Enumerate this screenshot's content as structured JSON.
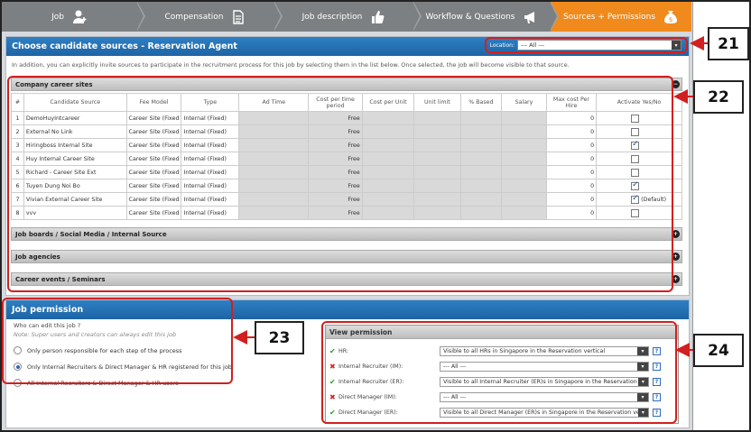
{
  "wizard": {
    "steps": [
      {
        "label": "Job",
        "icon": "add-user-icon"
      },
      {
        "label": "Compensation",
        "icon": "document-icon"
      },
      {
        "label": "Job description",
        "icon": "thumbs-up-icon"
      },
      {
        "label": "Workflow & Questions",
        "icon": "megaphone-icon"
      },
      {
        "label": "Sources + Permissions",
        "icon": "money-bag-icon"
      }
    ],
    "active_index": 4,
    "active_color": "#f08a1c"
  },
  "sources": {
    "title": "Choose candidate sources - Reservation Agent",
    "location_label": "Location:",
    "location_value": "--- All ---",
    "intro": "In addition, you can explicitly invite sources to participate in the recruitment process for this job by selecting them in the list below. Once selected, the job will become visible to that source.",
    "sections": {
      "company": "Company career sites",
      "job_boards": "Job boards / Social Media / Internal Source",
      "agencies": "Job agencies",
      "events": "Career events / Seminars"
    },
    "table": {
      "headers": [
        "#",
        "Candidate Source",
        "Fee Model",
        "Type",
        "Ad Time",
        "Cost per time period",
        "Cost per Unit",
        "Unit limit",
        "% Based",
        "Salary",
        "Max cost Per Hire",
        "Activate Yes/No"
      ],
      "rows": [
        {
          "n": "1",
          "source": "DemoHuyIntcareer",
          "fee": "Career Site (Fixed",
          "type": "Internal (Fixed)",
          "cost_time": "Free",
          "max": "0",
          "active": false,
          "note": ""
        },
        {
          "n": "2",
          "source": "External No Link",
          "fee": "Career Site (Fixed",
          "type": "Internal (Fixed)",
          "cost_time": "Free",
          "max": "0",
          "active": false,
          "note": ""
        },
        {
          "n": "3",
          "source": "Hiringboss Internal Site",
          "fee": "Career Site (Fixed",
          "type": "Internal (Fixed)",
          "cost_time": "Free",
          "max": "0",
          "active": true,
          "note": ""
        },
        {
          "n": "4",
          "source": "Huy Internal Career Site",
          "fee": "Career Site (Fixed",
          "type": "Internal (Fixed)",
          "cost_time": "Free",
          "max": "0",
          "active": false,
          "note": ""
        },
        {
          "n": "5",
          "source": "Richard - Career Site Ext",
          "fee": "Career Site (Fixed",
          "type": "Internal (Fixed)",
          "cost_time": "Free",
          "max": "0",
          "active": false,
          "note": ""
        },
        {
          "n": "6",
          "source": "Tuyen Dung Noi Bo",
          "fee": "Career Site (Fixed",
          "type": "Internal (Fixed)",
          "cost_time": "Free",
          "max": "0",
          "active": true,
          "note": ""
        },
        {
          "n": "7",
          "source": "Vivian External Career Site",
          "fee": "Career Site (Fixed",
          "type": "Internal (Fixed)",
          "cost_time": "Free",
          "max": "0",
          "active": true,
          "note": "(Default)"
        },
        {
          "n": "8",
          "source": "vvv",
          "fee": "Career Site (Fixed",
          "type": "Internal (Fixed)",
          "cost_time": "Free",
          "max": "0",
          "active": false,
          "note": ""
        }
      ]
    }
  },
  "permission": {
    "title": "Job permission",
    "question": "Who can edit this job ?",
    "note": "Note: Super users and creators can always edit this job",
    "options": [
      {
        "label": "Only person responsible for each step of the process",
        "selected": false
      },
      {
        "label": "Only Internal Recruiters & Direct Manager & HR registered for this job",
        "selected": true
      },
      {
        "label": "All Internal Recruiters & Direct Manager & HR users",
        "selected": false
      }
    ]
  },
  "view_permission": {
    "title": "View permission",
    "rows": [
      {
        "status": "ok",
        "mark": "✔",
        "label": "HR:",
        "value": "Visible to all HRs in Singapore in the Reservation vertical"
      },
      {
        "status": "no",
        "mark": "✖",
        "label": "Internal Recruiter (IM):",
        "value": "--- All ---"
      },
      {
        "status": "ok",
        "mark": "✔",
        "label": "Internal Recruiter (ER):",
        "value": "Visible to all Internal Recruiter (ER)s in Singapore in the Reservation vert"
      },
      {
        "status": "no",
        "mark": "✖",
        "label": "Direct Manager (IM):",
        "value": "--- All ---"
      },
      {
        "status": "ok",
        "mark": "✔",
        "label": "Direct Manager (ER):",
        "value": "Visible to all Direct Manager (ER)s in Singapore in the Reservation vertic"
      }
    ],
    "help": "?"
  },
  "callouts": {
    "c21": "21",
    "c22": "22",
    "c23": "23",
    "c24": "24"
  },
  "highlight_color": "#d21f1f"
}
